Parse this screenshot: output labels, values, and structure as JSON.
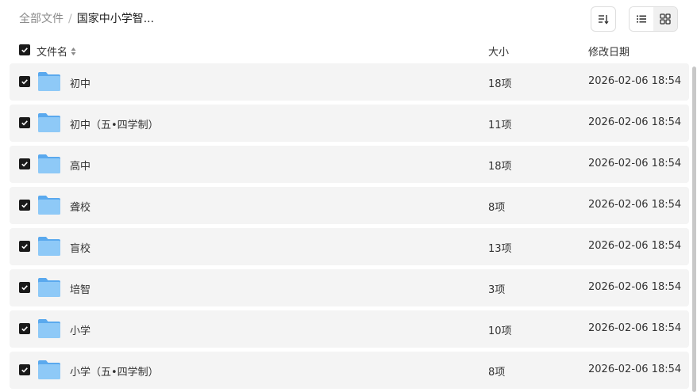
{
  "breadcrumb": {
    "root": "全部文件",
    "separator": "/",
    "current": "国家中小学智..."
  },
  "toolbar": {
    "sort_icon": "sort-icon",
    "list_view_icon": "list-view-icon",
    "grid_view_icon": "grid-view-icon",
    "active_view": "list"
  },
  "table": {
    "headers": {
      "name": "文件名",
      "size": "大小",
      "modified": "修改日期"
    },
    "rows": [
      {
        "name": "初中",
        "size": "18项",
        "modified": "2026-02-06 18:54",
        "checked": true
      },
      {
        "name": "初中（五•四学制）",
        "size": "11项",
        "modified": "2026-02-06 18:54",
        "checked": true
      },
      {
        "name": "高中",
        "size": "18项",
        "modified": "2026-02-06 18:54",
        "checked": true
      },
      {
        "name": "聋校",
        "size": "8项",
        "modified": "2026-02-06 18:54",
        "checked": true
      },
      {
        "name": "盲校",
        "size": "13项",
        "modified": "2026-02-06 18:54",
        "checked": true
      },
      {
        "name": "培智",
        "size": "3项",
        "modified": "2026-02-06 18:54",
        "checked": true
      },
      {
        "name": "小学",
        "size": "10项",
        "modified": "2026-02-06 18:54",
        "checked": true
      },
      {
        "name": "小学（五•四学制）",
        "size": "8项",
        "modified": "2026-02-06 18:54",
        "checked": true
      }
    ]
  },
  "colors": {
    "row_background": "#f4f4f4",
    "checkbox": "#1a1a1a",
    "folder_light": "#8ec9f7",
    "folder_dark": "#5aa9ee"
  }
}
